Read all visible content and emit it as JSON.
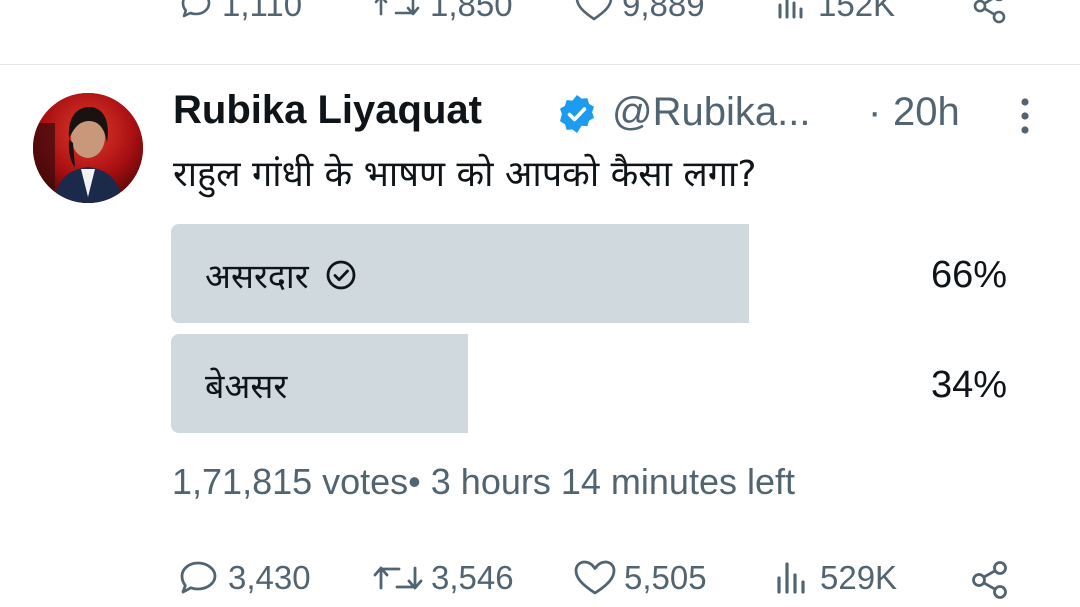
{
  "previous_tweet": {
    "replies": "1,110",
    "retweets": "1,850",
    "likes": "9,889",
    "views": "152K"
  },
  "tweet": {
    "author_name": "Rubika Liyaquat",
    "handle": "@Rubika...",
    "separator": "·",
    "timestamp": "20h",
    "text": "राहुल गांधी के भाषण को आपको कैसा लगा?",
    "poll": {
      "options": [
        {
          "label": "असरदार",
          "percent_label": "66%",
          "percent": 66,
          "selected": true
        },
        {
          "label": "बेअसर",
          "percent_label": "34%",
          "percent": 34,
          "selected": false
        }
      ],
      "meta": "1,71,815 votes• 3 hours 14 minutes left"
    },
    "actions": {
      "replies": "3,430",
      "retweets": "3,546",
      "likes": "5,505",
      "views": "529K"
    }
  },
  "icons": {
    "verified": "verified-badge-icon",
    "more": "more-vertical-icon",
    "reply": "reply-icon",
    "retweet": "retweet-icon",
    "like": "heart-icon",
    "views": "views-icon",
    "share": "share-icon",
    "selected_choice": "check-circle-icon"
  },
  "colors": {
    "text": "#0f1419",
    "secondary": "#536471",
    "verified": "#1d9bf0",
    "poll_bar": "#cfd9de",
    "divider": "#e6e9eb"
  }
}
